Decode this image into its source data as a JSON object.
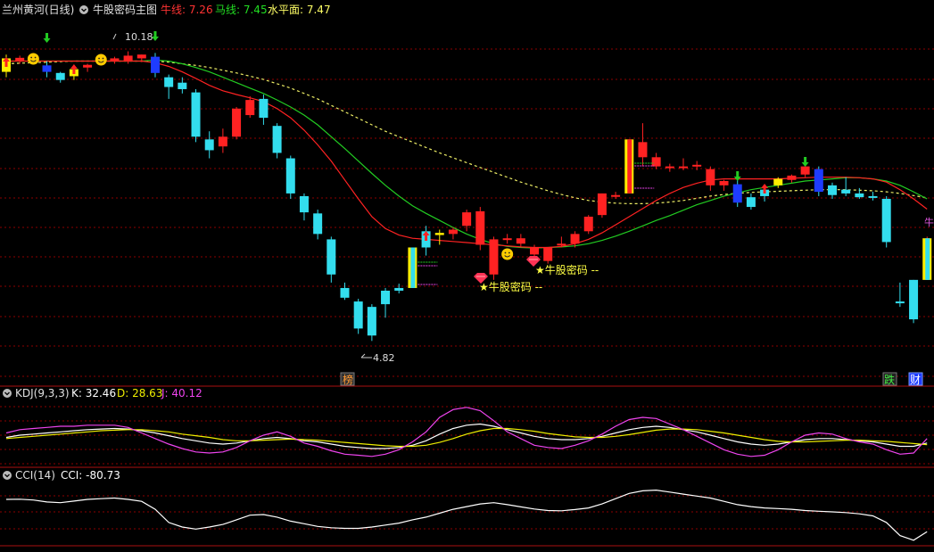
{
  "header": {
    "symbol": "兰州黄河(日线)",
    "indicator_name": "牛股密码主图",
    "niu_label": "牛线: 7.26",
    "ma_label": "马线: 7.45",
    "level_label": "水平面: 7.47"
  },
  "kdj_header": {
    "name": "KDJ(9,3,3)",
    "k_label": "K: 32.46",
    "d_label": "D: 28.63",
    "j_label": "J: 40.12"
  },
  "cci_header": {
    "name": "CCI(14)",
    "cci_label": "CCI: -80.73"
  },
  "colors": {
    "bg": "#000000",
    "grid": "#8b0000",
    "up": "#ff2222",
    "down": "#33ddee",
    "blue_candle": "#1e3cff",
    "yellow": "#ffee00",
    "niu_line": "#ff2222",
    "ma_line": "#22cc22",
    "level_line": "#eeee66",
    "k_line": "#ffffff",
    "d_line": "#eeee00",
    "j_line": "#ee44ee",
    "cci_line": "#ffffff",
    "green_text": "#22dd22"
  },
  "annotations": {
    "high_label": "10.18",
    "low_label": "4.82",
    "signal_text_1": "★牛股密码 --",
    "signal_text_2": "★牛股密码 --",
    "badge_bang": "榜",
    "badge_die": "跌",
    "badge_cai": "财",
    "edge_label": "牛"
  },
  "chart_data": [
    {
      "type": "candlestick",
      "name_shown": "牛股密码主图",
      "ylim": [
        4.0,
        10.8
      ],
      "candles": [
        {
          "o": 9.8,
          "h": 10.12,
          "l": 9.7,
          "c": 10.05,
          "color": "yellow"
        },
        {
          "o": 10.0,
          "h": 10.1,
          "l": 9.95,
          "c": 10.06,
          "color": "up"
        },
        {
          "o": 10.02,
          "h": 10.08,
          "l": 9.95,
          "c": 9.98,
          "color": "up"
        },
        {
          "o": 9.92,
          "h": 10.0,
          "l": 9.7,
          "c": 9.8,
          "color": "blue"
        },
        {
          "o": 9.78,
          "h": 9.8,
          "l": 9.6,
          "c": 9.65,
          "color": "down"
        },
        {
          "o": 9.72,
          "h": 9.85,
          "l": 9.65,
          "c": 9.85,
          "color": "yellow"
        },
        {
          "o": 9.88,
          "h": 9.95,
          "l": 9.8,
          "c": 9.93,
          "color": "up"
        },
        {
          "o": 9.98,
          "h": 10.05,
          "l": 9.92,
          "c": 10.02,
          "color": "up"
        },
        {
          "o": 10.0,
          "h": 10.08,
          "l": 9.95,
          "c": 10.05,
          "color": "up"
        },
        {
          "o": 10.0,
          "h": 10.18,
          "l": 9.95,
          "c": 10.1,
          "color": "up"
        },
        {
          "o": 10.05,
          "h": 10.12,
          "l": 9.98,
          "c": 10.12,
          "color": "up"
        },
        {
          "o": 10.08,
          "h": 10.15,
          "l": 9.7,
          "c": 9.78,
          "color": "blue"
        },
        {
          "o": 9.7,
          "h": 9.75,
          "l": 9.3,
          "c": 9.52,
          "color": "down"
        },
        {
          "o": 9.6,
          "h": 9.7,
          "l": 9.4,
          "c": 9.48,
          "color": "down"
        },
        {
          "o": 9.42,
          "h": 9.48,
          "l": 8.5,
          "c": 8.6,
          "color": "down"
        },
        {
          "o": 8.55,
          "h": 8.7,
          "l": 8.2,
          "c": 8.35,
          "color": "down"
        },
        {
          "o": 8.42,
          "h": 8.75,
          "l": 8.3,
          "c": 8.6,
          "color": "up"
        },
        {
          "o": 8.6,
          "h": 9.15,
          "l": 8.55,
          "c": 9.12,
          "color": "up"
        },
        {
          "o": 9.0,
          "h": 9.35,
          "l": 8.95,
          "c": 9.28,
          "color": "up"
        },
        {
          "o": 9.3,
          "h": 9.38,
          "l": 8.82,
          "c": 8.95,
          "color": "down"
        },
        {
          "o": 8.8,
          "h": 8.85,
          "l": 8.2,
          "c": 8.3,
          "color": "down"
        },
        {
          "o": 8.2,
          "h": 8.25,
          "l": 7.45,
          "c": 7.55,
          "color": "down"
        },
        {
          "o": 7.5,
          "h": 7.55,
          "l": 7.05,
          "c": 7.2,
          "color": "down"
        },
        {
          "o": 7.18,
          "h": 7.25,
          "l": 6.7,
          "c": 6.8,
          "color": "down"
        },
        {
          "o": 6.7,
          "h": 6.75,
          "l": 5.9,
          "c": 6.05,
          "color": "down"
        },
        {
          "o": 5.8,
          "h": 5.9,
          "l": 5.58,
          "c": 5.62,
          "color": "down"
        },
        {
          "o": 5.55,
          "h": 5.6,
          "l": 4.95,
          "c": 5.05,
          "color": "down"
        },
        {
          "o": 5.45,
          "h": 5.5,
          "l": 4.82,
          "c": 4.92,
          "color": "down"
        },
        {
          "o": 5.5,
          "h": 5.8,
          "l": 5.25,
          "c": 5.75,
          "color": "down"
        },
        {
          "o": 5.75,
          "h": 5.88,
          "l": 5.7,
          "c": 5.8,
          "color": "down"
        },
        {
          "o": 5.8,
          "h": 6.55,
          "l": 5.8,
          "c": 6.55,
          "color": "yellow_cyan"
        },
        {
          "o": 6.55,
          "h": 6.95,
          "l": 6.4,
          "c": 6.85,
          "color": "down"
        },
        {
          "o": 6.78,
          "h": 6.88,
          "l": 6.6,
          "c": 6.82,
          "color": "yellow"
        },
        {
          "o": 6.8,
          "h": 6.92,
          "l": 6.7,
          "c": 6.88,
          "color": "up"
        },
        {
          "o": 6.95,
          "h": 7.25,
          "l": 6.85,
          "c": 7.2,
          "color": "up"
        },
        {
          "o": 7.22,
          "h": 7.3,
          "l": 6.5,
          "c": 6.6,
          "color": "up"
        },
        {
          "o": 6.7,
          "h": 6.75,
          "l": 5.95,
          "c": 6.05,
          "color": "up"
        },
        {
          "o": 6.72,
          "h": 6.8,
          "l": 6.62,
          "c": 6.7,
          "color": "up"
        },
        {
          "o": 6.72,
          "h": 6.8,
          "l": 6.55,
          "c": 6.62,
          "color": "up"
        },
        {
          "o": 6.42,
          "h": 6.6,
          "l": 6.35,
          "c": 6.55,
          "color": "up"
        },
        {
          "o": 6.3,
          "h": 6.55,
          "l": 6.25,
          "c": 6.55,
          "color": "up"
        },
        {
          "o": 6.62,
          "h": 6.75,
          "l": 6.55,
          "c": 6.62,
          "color": "up"
        },
        {
          "o": 6.62,
          "h": 6.85,
          "l": 6.55,
          "c": 6.8,
          "color": "up"
        },
        {
          "o": 6.85,
          "h": 7.15,
          "l": 6.8,
          "c": 7.12,
          "color": "up"
        },
        {
          "o": 7.15,
          "h": 7.55,
          "l": 7.1,
          "c": 7.55,
          "color": "up"
        },
        {
          "o": 7.5,
          "h": 7.58,
          "l": 7.45,
          "c": 7.52,
          "color": "up"
        },
        {
          "o": 7.55,
          "h": 8.55,
          "l": 7.55,
          "c": 8.55,
          "color": "yellow_up"
        },
        {
          "o": 8.5,
          "h": 8.85,
          "l": 8.05,
          "c": 8.22,
          "color": "up"
        },
        {
          "o": 8.22,
          "h": 8.3,
          "l": 8.0,
          "c": 8.05,
          "color": "up"
        },
        {
          "o": 8.05,
          "h": 8.1,
          "l": 7.95,
          "c": 8.02,
          "color": "up"
        },
        {
          "o": 8.05,
          "h": 8.2,
          "l": 7.98,
          "c": 8.05,
          "color": "up"
        },
        {
          "o": 8.05,
          "h": 8.15,
          "l": 7.98,
          "c": 8.08,
          "color": "up"
        },
        {
          "o": 8.0,
          "h": 8.05,
          "l": 7.6,
          "c": 7.7,
          "color": "up"
        },
        {
          "o": 7.7,
          "h": 7.8,
          "l": 7.6,
          "c": 7.78,
          "color": "up"
        },
        {
          "o": 7.72,
          "h": 7.8,
          "l": 7.3,
          "c": 7.38,
          "color": "blue"
        },
        {
          "o": 7.48,
          "h": 7.55,
          "l": 7.25,
          "c": 7.3,
          "color": "down"
        },
        {
          "o": 7.5,
          "h": 7.65,
          "l": 7.4,
          "c": 7.62,
          "color": "down"
        },
        {
          "o": 7.7,
          "h": 7.85,
          "l": 7.65,
          "c": 7.82,
          "color": "yellow"
        },
        {
          "o": 7.8,
          "h": 7.9,
          "l": 7.75,
          "c": 7.88,
          "color": "up"
        },
        {
          "o": 7.9,
          "h": 8.05,
          "l": 7.85,
          "c": 8.05,
          "color": "up"
        },
        {
          "o": 8.0,
          "h": 8.05,
          "l": 7.5,
          "c": 7.58,
          "color": "blue"
        },
        {
          "o": 7.7,
          "h": 7.75,
          "l": 7.45,
          "c": 7.52,
          "color": "down"
        },
        {
          "o": 7.62,
          "h": 7.85,
          "l": 7.5,
          "c": 7.55,
          "color": "down"
        },
        {
          "o": 7.55,
          "h": 7.65,
          "l": 7.45,
          "c": 7.48,
          "color": "down"
        },
        {
          "o": 7.5,
          "h": 7.58,
          "l": 7.42,
          "c": 7.5,
          "color": "down"
        },
        {
          "o": 7.45,
          "h": 7.5,
          "l": 6.55,
          "c": 6.65,
          "color": "down"
        },
        {
          "o": 5.55,
          "h": 5.9,
          "l": 5.45,
          "c": 5.52,
          "color": "down"
        },
        {
          "o": 5.95,
          "h": 5.95,
          "l": 5.15,
          "c": 5.22,
          "color": "down"
        },
        {
          "o": 5.95,
          "h": 6.75,
          "l": 5.95,
          "c": 6.72,
          "color": "yellow_cyan"
        }
      ],
      "niu_line": [
        10.0,
        10.0,
        10.0,
        10.0,
        10.0,
        10.0,
        10.0,
        10.0,
        10.0,
        10.0,
        10.0,
        9.97,
        9.9,
        9.8,
        9.68,
        9.55,
        9.45,
        9.38,
        9.32,
        9.25,
        9.12,
        8.95,
        8.72,
        8.45,
        8.15,
        7.8,
        7.45,
        7.12,
        6.9,
        6.78,
        6.72,
        6.7,
        6.68,
        6.66,
        6.64,
        6.62,
        6.6,
        6.58,
        6.56,
        6.55,
        6.55,
        6.57,
        6.62,
        6.7,
        6.82,
        6.97,
        7.12,
        7.27,
        7.42,
        7.55,
        7.66,
        7.74,
        7.8,
        7.82,
        7.82,
        7.82,
        7.82,
        7.82,
        7.83,
        7.84,
        7.85,
        7.85,
        7.85,
        7.84,
        7.82,
        7.76,
        7.62,
        7.45,
        7.26
      ],
      "ma_line": [
        10.0,
        10.0,
        10.0,
        10.0,
        10.0,
        10.0,
        10.0,
        10.0,
        10.0,
        10.0,
        10.0,
        10.02,
        10.0,
        9.95,
        9.88,
        9.8,
        9.7,
        9.6,
        9.5,
        9.4,
        9.28,
        9.15,
        9.0,
        8.82,
        8.6,
        8.38,
        8.15,
        7.92,
        7.7,
        7.5,
        7.32,
        7.18,
        7.05,
        6.92,
        6.8,
        6.7,
        6.62,
        6.57,
        6.55,
        6.54,
        6.55,
        6.56,
        6.58,
        6.62,
        6.68,
        6.76,
        6.85,
        6.95,
        7.05,
        7.14,
        7.24,
        7.34,
        7.42,
        7.5,
        7.56,
        7.62,
        7.66,
        7.7,
        7.74,
        7.78,
        7.8,
        7.82,
        7.84,
        7.84,
        7.82,
        7.78,
        7.7,
        7.58,
        7.45
      ],
      "level_line": [
        9.95,
        9.96,
        9.97,
        9.98,
        9.99,
        10.0,
        10.0,
        10.0,
        10.0,
        10.0,
        10.0,
        10.0,
        9.98,
        9.95,
        9.92,
        9.88,
        9.83,
        9.78,
        9.72,
        9.66,
        9.58,
        9.5,
        9.4,
        9.3,
        9.18,
        9.06,
        8.94,
        8.82,
        8.7,
        8.6,
        8.5,
        8.4,
        8.3,
        8.21,
        8.12,
        8.03,
        7.94,
        7.85,
        7.76,
        7.68,
        7.6,
        7.53,
        7.47,
        7.42,
        7.39,
        7.37,
        7.36,
        7.36,
        7.37,
        7.39,
        7.42,
        7.46,
        7.5,
        7.53,
        7.55,
        7.57,
        7.58,
        7.59,
        7.6,
        7.61,
        7.62,
        7.62,
        7.62,
        7.61,
        7.6,
        7.58,
        7.55,
        7.51,
        7.47
      ],
      "annotations": [
        {
          "text": "10.18",
          "index": 9,
          "value": 10.18
        },
        {
          "text": "4.82",
          "index": 27,
          "value": 4.82
        }
      ]
    },
    {
      "type": "line",
      "name_shown": "KDJ(9,3,3)",
      "ylim": [
        -10,
        110
      ],
      "series": [
        {
          "name": "K",
          "values": [
            42,
            46,
            48,
            50,
            52,
            54,
            56,
            57,
            58,
            57,
            54,
            50,
            45,
            40,
            36,
            32,
            30,
            32,
            36,
            40,
            42,
            40,
            36,
            34,
            30,
            26,
            24,
            22,
            22,
            24,
            28,
            36,
            48,
            58,
            64,
            66,
            62,
            56,
            50,
            44,
            40,
            38,
            38,
            40,
            44,
            50,
            56,
            60,
            62,
            60,
            56,
            52,
            46,
            40,
            34,
            30,
            28,
            30,
            34,
            38,
            40,
            40,
            38,
            36,
            34,
            30,
            26,
            26,
            32
          ]
        },
        {
          "name": "D",
          "values": [
            40,
            42,
            44,
            46,
            48,
            50,
            52,
            54,
            55,
            56,
            56,
            54,
            52,
            48,
            45,
            42,
            38,
            36,
            36,
            37,
            38,
            39,
            38,
            37,
            35,
            33,
            31,
            29,
            27,
            26,
            26,
            28,
            33,
            40,
            48,
            54,
            58,
            58,
            56,
            53,
            49,
            46,
            43,
            42,
            42,
            44,
            47,
            51,
            55,
            57,
            57,
            56,
            53,
            50,
            46,
            42,
            38,
            35,
            34,
            34,
            35,
            36,
            37,
            37,
            36,
            35,
            33,
            31,
            29
          ]
        },
        {
          "name": "J",
          "values": [
            50,
            56,
            58,
            60,
            62,
            62,
            64,
            64,
            64,
            60,
            50,
            40,
            30,
            22,
            16,
            14,
            16,
            24,
            36,
            46,
            52,
            44,
            32,
            26,
            18,
            12,
            10,
            8,
            12,
            20,
            34,
            52,
            78,
            92,
            96,
            90,
            72,
            52,
            40,
            28,
            24,
            22,
            28,
            36,
            48,
            62,
            74,
            78,
            76,
            66,
            56,
            44,
            32,
            20,
            12,
            8,
            10,
            20,
            34,
            46,
            50,
            48,
            40,
            34,
            30,
            20,
            12,
            14,
            40
          ]
        }
      ]
    },
    {
      "type": "line",
      "name_shown": "CCI(14)",
      "ylim": [
        -250,
        230
      ],
      "series": [
        {
          "name": "CCI",
          "values": [
            95,
            96,
            90,
            75,
            70,
            82,
            95,
            100,
            105,
            95,
            80,
            20,
            -80,
            -115,
            -130,
            -115,
            -95,
            -60,
            -25,
            -20,
            -40,
            -70,
            -90,
            -110,
            -120,
            -125,
            -125,
            -115,
            -100,
            -85,
            -60,
            -40,
            -10,
            20,
            40,
            60,
            70,
            55,
            38,
            22,
            10,
            8,
            18,
            30,
            60,
            100,
            140,
            160,
            165,
            150,
            135,
            120,
            105,
            80,
            55,
            40,
            30,
            25,
            20,
            10,
            5,
            0,
            -5,
            -15,
            -30,
            -80,
            -180,
            -215,
            -150
          ]
        }
      ]
    }
  ]
}
